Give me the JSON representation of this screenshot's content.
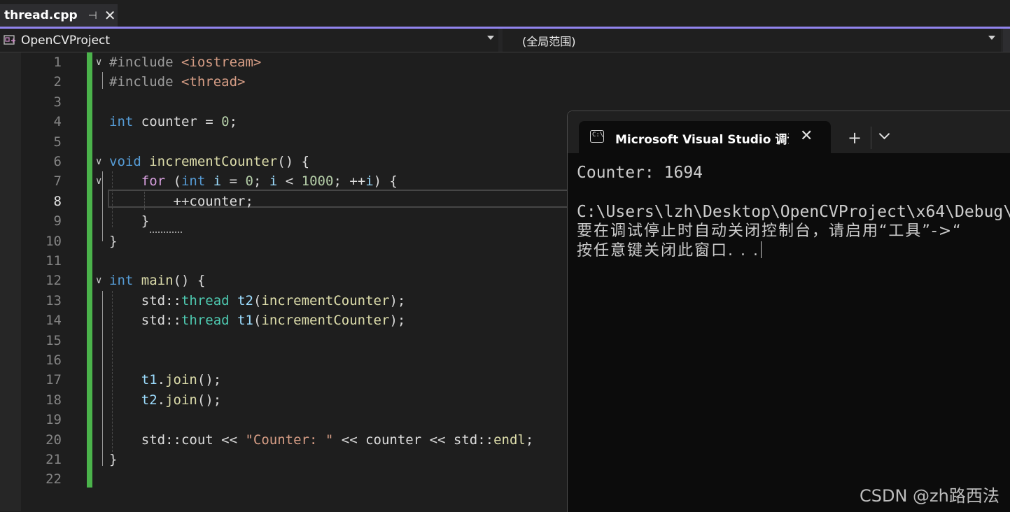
{
  "tab": {
    "filename": "thread.cpp",
    "pin_glyph": "⊣",
    "close_glyph": "✕"
  },
  "nav": {
    "project": "OpenCVProject",
    "scope": "(全局范围)"
  },
  "line_numbers": [
    "1",
    "2",
    "3",
    "4",
    "5",
    "6",
    "7",
    "8",
    "9",
    "10",
    "11",
    "12",
    "13",
    "14",
    "15",
    "16",
    "17",
    "18",
    "19",
    "20",
    "21",
    "22"
  ],
  "current_line": "8",
  "code": {
    "l1": [
      "#include ",
      "<iostream>"
    ],
    "l2": [
      "#include ",
      "<thread>"
    ],
    "l4": [
      "int",
      " counter = ",
      "0",
      ";"
    ],
    "l6": [
      "void",
      " ",
      "incrementCounter",
      "() {"
    ],
    "l7": [
      "for",
      " (",
      "int",
      " ",
      "i",
      " = ",
      "0",
      "; ",
      "i",
      " < ",
      "1000",
      "; ++",
      "i",
      ") {"
    ],
    "l8": [
      "++counter;"
    ],
    "l9": [
      "}"
    ],
    "l10": [
      "}"
    ],
    "l12": [
      "int",
      " ",
      "main",
      "() {"
    ],
    "l13": [
      "std::",
      "thread",
      " ",
      "t2",
      "(",
      "incrementCounter",
      ");"
    ],
    "l14": [
      "std::",
      "thread",
      " ",
      "t1",
      "(",
      "incrementCounter",
      ");"
    ],
    "l17": [
      "t1",
      ".",
      "join",
      "();"
    ],
    "l18": [
      "t2",
      ".",
      "join",
      "();"
    ],
    "l20": [
      "std::cout << ",
      "\"Counter: \"",
      " << counter << std::",
      "endl",
      ";"
    ],
    "l21": [
      "}"
    ]
  },
  "console": {
    "title": "Microsoft Visual Studio 调试控制台",
    "icon_text": "C:\\",
    "close_glyph": "✕",
    "new_tab_glyph": "+",
    "lines": [
      "Counter: 1694",
      "",
      "C:\\Users\\lzh\\Desktop\\OpenCVProject\\x64\\Debug\\",
      "要在调试停止时自动关闭控制台，请启用“工具”->“",
      "按任意键关闭此窗口. . ."
    ]
  },
  "watermark": "CSDN @zh路西法",
  "colors": {
    "accent": "#9184ee",
    "change_bar": "#4bb34b",
    "keyword": "#569cd6",
    "control": "#d8a0df",
    "function": "#dcdcaa",
    "type": "#4ec9b0",
    "number": "#b5cea8",
    "string": "#d69d85"
  }
}
